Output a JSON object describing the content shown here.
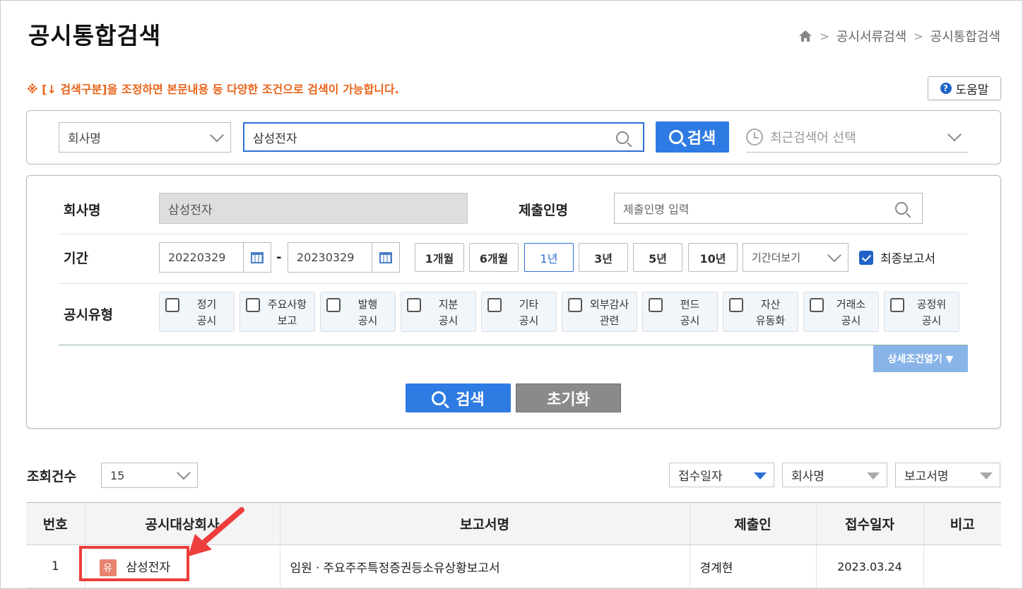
{
  "header": {
    "title": "공시통합검색",
    "breadcrumb": [
      "공시서류검색",
      "공시통합검색"
    ]
  },
  "notice": "※ [↓ 검색구분]을 조정하면 본문내용 등 다양한 조건으로 검색이 가능합니다.",
  "help_label": "도움말",
  "quick_search": {
    "category": "회사명",
    "query": "삼성전자",
    "button": "검색",
    "recent_placeholder": "최근검색어 선택"
  },
  "form": {
    "company_label": "회사명",
    "company_value": "삼성전자",
    "submitter_label": "제출인명",
    "submitter_placeholder": "제출인명 입력",
    "period_label": "기간",
    "start_date": "20220329",
    "end_date": "20230329",
    "period_buttons": [
      "1개월",
      "6개월",
      "1년",
      "3년",
      "5년",
      "10년"
    ],
    "active_period": "1년",
    "period_more": "기간더보기",
    "final_report_label": "최종보고서",
    "final_report_checked": true,
    "type_label": "공시유형",
    "types": [
      {
        "l1": "정기",
        "l2": "공시"
      },
      {
        "l1": "주요사항",
        "l2": "보고"
      },
      {
        "l1": "발행",
        "l2": "공시"
      },
      {
        "l1": "지분",
        "l2": "공시"
      },
      {
        "l1": "기타",
        "l2": "공시"
      },
      {
        "l1": "외부감사",
        "l2": "관련"
      },
      {
        "l1": "펀드",
        "l2": "공시"
      },
      {
        "l1": "자산",
        "l2": "유동화"
      },
      {
        "l1": "거래소",
        "l2": "공시"
      },
      {
        "l1": "공정위",
        "l2": "공시"
      }
    ],
    "detail_toggle": "상세조건열기 ▼",
    "search_button": "검색",
    "reset_button": "초기화"
  },
  "results": {
    "count_label": "조회건수",
    "count_value": "15",
    "sort": [
      "접수일자",
      "회사명",
      "보고서명"
    ],
    "columns": [
      "번호",
      "공시대상회사",
      "보고서명",
      "제출인",
      "접수일자",
      "비고"
    ],
    "rows": [
      {
        "no": "1",
        "badge": "유",
        "company": "삼성전자",
        "report": "임원ㆍ주요주주특정증권등소유상황보고서",
        "submitter": "경계현",
        "date": "2023.03.24",
        "note": ""
      }
    ]
  },
  "colors": {
    "accent": "#2e7be3",
    "notice": "#e8641b",
    "highlight": "#ee3d3d",
    "badge": "#e8826f"
  }
}
